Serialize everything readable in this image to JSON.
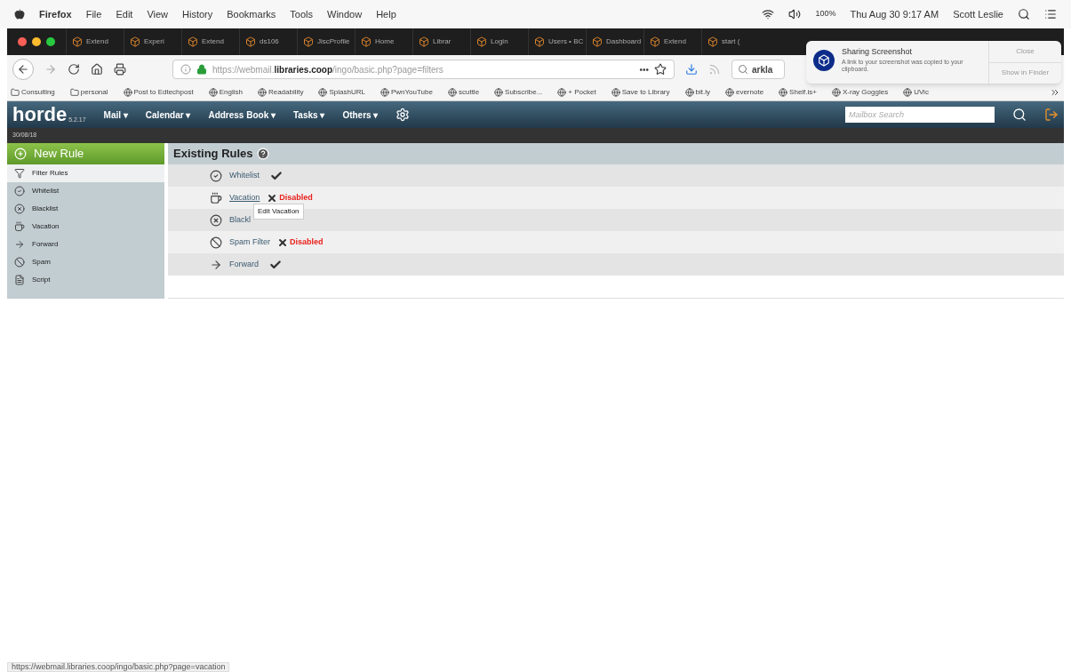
{
  "menubar": {
    "app": "Firefox",
    "menus": [
      "File",
      "Edit",
      "View",
      "History",
      "Bookmarks",
      "Tools",
      "Window",
      "Help"
    ],
    "battery": "100%",
    "clock": "Thu Aug 30  9:17 AM",
    "user": "Scott Leslie"
  },
  "tabs": [
    {
      "label": "Extend",
      "selected": false
    },
    {
      "label": "Experi",
      "selected": false
    },
    {
      "label": "Extend",
      "selected": false
    },
    {
      "label": "ds106",
      "selected": false
    },
    {
      "label": "JiscProfile",
      "selected": false
    },
    {
      "label": "Home",
      "selected": false
    },
    {
      "label": "Librar",
      "selected": false
    },
    {
      "label": "Login",
      "selected": false
    },
    {
      "label": "Users • BC",
      "selected": false
    },
    {
      "label": "Dashboard",
      "selected": false
    },
    {
      "label": "Extend",
      "selected": false
    },
    {
      "label": "start (",
      "selected": false
    }
  ],
  "address_bar": {
    "url": "https://webmail.**libraries.coop**/ingo/basic.php?page=filters",
    "more": "•••"
  },
  "search_field": {
    "value": "arkla"
  },
  "bookmarks": [
    {
      "label": "Consulting",
      "kind": "folder"
    },
    {
      "label": "personal",
      "kind": "folder"
    },
    {
      "label": "Post to Edtechpost",
      "kind": "site"
    },
    {
      "label": "English",
      "kind": "site"
    },
    {
      "label": "Readability",
      "kind": "site"
    },
    {
      "label": "SplashURL",
      "kind": "site"
    },
    {
      "label": "PwnYouTube",
      "kind": "site"
    },
    {
      "label": "scuttle",
      "kind": "site"
    },
    {
      "label": "Subscribe...",
      "kind": "site"
    },
    {
      "label": "+ Pocket",
      "kind": "site"
    },
    {
      "label": "Save to Library",
      "kind": "site"
    },
    {
      "label": "bit.ly",
      "kind": "site"
    },
    {
      "label": "evernote",
      "kind": "site"
    },
    {
      "label": "Shelf.is+",
      "kind": "site"
    },
    {
      "label": "X-ray Goggles",
      "kind": "site"
    },
    {
      "label": "UVic",
      "kind": "site"
    }
  ],
  "notification": {
    "title": "Sharing Screenshot",
    "body": "A link to your screenshot was copied to your clipboard.",
    "buttons": [
      "Close",
      "Show in Finder"
    ]
  },
  "horde": {
    "logo": "horde",
    "version": "5.2.17",
    "menu": [
      {
        "label": "Mail",
        "caret": "▾"
      },
      {
        "label": "Calendar",
        "caret": "▾"
      },
      {
        "label": "Address Book",
        "caret": "▾"
      },
      {
        "label": "Tasks",
        "caret": "▾"
      },
      {
        "label": "Others",
        "caret": "▾"
      }
    ],
    "search": {
      "placeholder": "Mailbox Search"
    },
    "date": "30/08/18"
  },
  "sidebar": {
    "new_rule": "New Rule",
    "items": [
      {
        "label": "Filter Rules",
        "kind": "filter",
        "selected": true
      },
      {
        "label": "Whitelist",
        "kind": "whitelist",
        "selected": false
      },
      {
        "label": "Blacklist",
        "kind": "blacklist",
        "selected": false
      },
      {
        "label": "Vacation",
        "kind": "vacation",
        "selected": false
      },
      {
        "label": "Forward",
        "kind": "forward",
        "selected": false
      },
      {
        "label": "Spam",
        "kind": "spam",
        "selected": false
      },
      {
        "label": "Script",
        "kind": "script",
        "selected": false
      }
    ]
  },
  "rules": {
    "title": "Existing Rules",
    "items": [
      {
        "name": "Whitelist",
        "kind": "whitelist",
        "hovered": false,
        "enabled": true
      },
      {
        "name": "Vacation",
        "kind": "vacation",
        "hovered": true,
        "enabled": false,
        "status_text": "Disabled"
      },
      {
        "name": "Blackl",
        "kind": "blacklist",
        "hovered": false
      },
      {
        "name": "Spam Filter",
        "kind": "spam",
        "hovered": false,
        "enabled": false,
        "status_text": "Disabled"
      },
      {
        "name": "Forward",
        "kind": "forward",
        "hovered": false,
        "enabled": true
      }
    ],
    "tooltip": "Edit Vacation"
  },
  "status_bar": "https://webmail.libraries.coop/ingo/basic.php?page=vacation"
}
